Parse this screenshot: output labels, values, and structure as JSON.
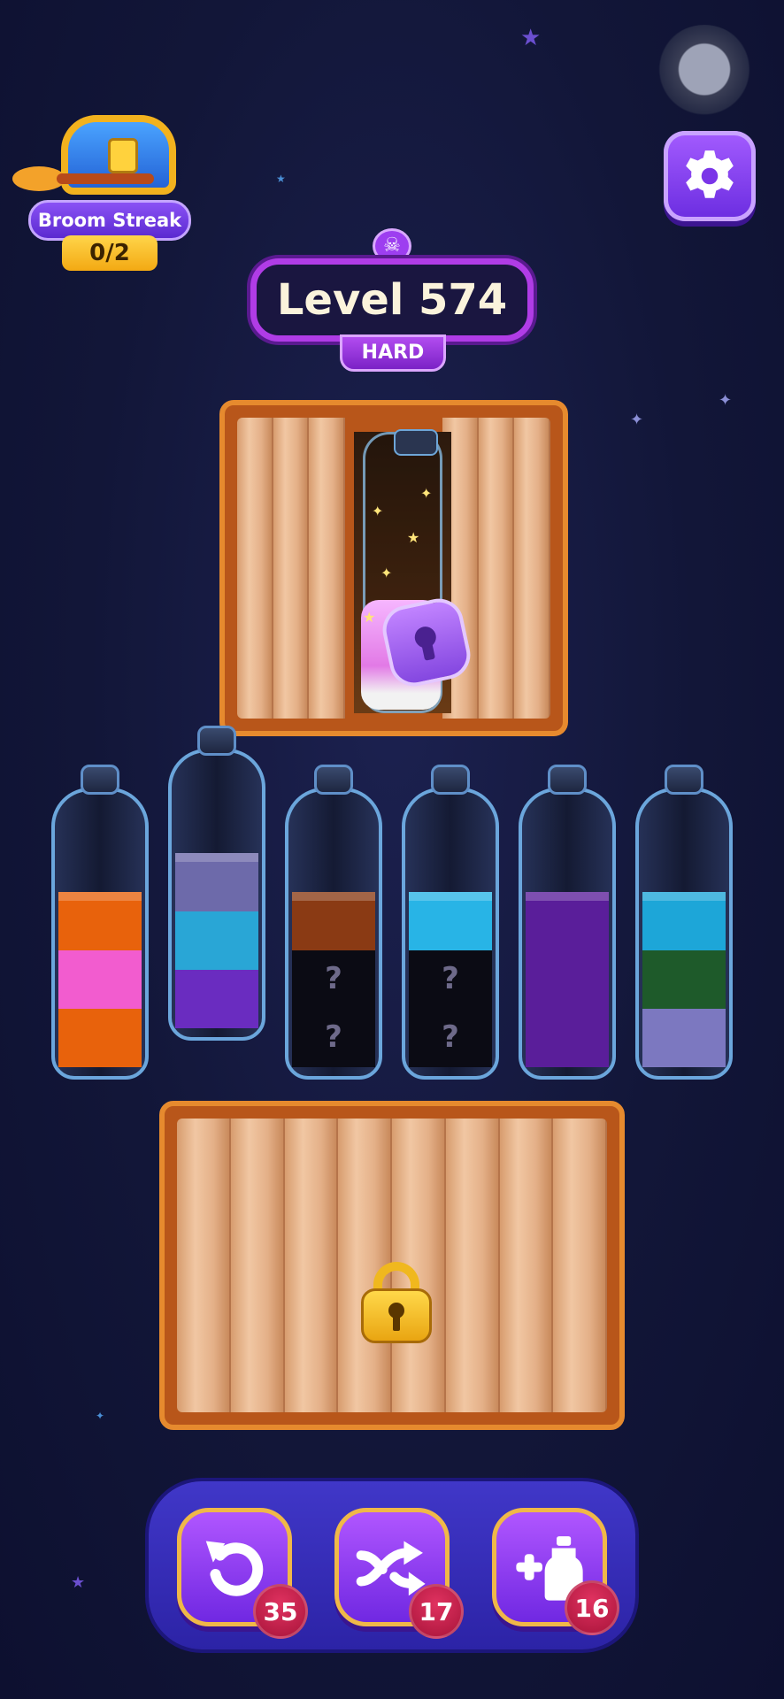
{
  "broom_streak": {
    "label": "Broom Streak",
    "progress": "0/2"
  },
  "level": {
    "title": "Level 574",
    "difficulty": "HARD"
  },
  "icons": {
    "settings": "gear-icon",
    "skull": "skull-icon",
    "undo": "undo-icon",
    "shuffle": "shuffle-icon",
    "add_bottle": "add-bottle-icon",
    "lock": "lock-icon"
  },
  "bottles": [
    {
      "segments": [
        "#e8620c",
        "#f25ccf",
        "#e8620c"
      ],
      "hidden": 0
    },
    {
      "segments": [
        "#6a2cc0",
        "#29a6d6",
        "#6d6aaa"
      ],
      "hidden": 0
    },
    {
      "segments": [
        "#8a3a14"
      ],
      "hidden": 2
    },
    {
      "segments": [
        "#28b4e6"
      ],
      "hidden": 2
    },
    {
      "segments": [
        "#5a1e9a",
        "#5a1e9a",
        "#5a1e9a"
      ],
      "hidden": 0
    },
    {
      "segments": [
        "#7c78c0",
        "#1e5a2a",
        "#1da6d8"
      ],
      "hidden": 0
    }
  ],
  "powerups": {
    "undo_count": "35",
    "shuffle_count": "17",
    "add_bottle_count": "16"
  },
  "colors": {
    "accent": "#8f45f0",
    "wood": "#e4b088",
    "badge": "#c21e4a"
  }
}
